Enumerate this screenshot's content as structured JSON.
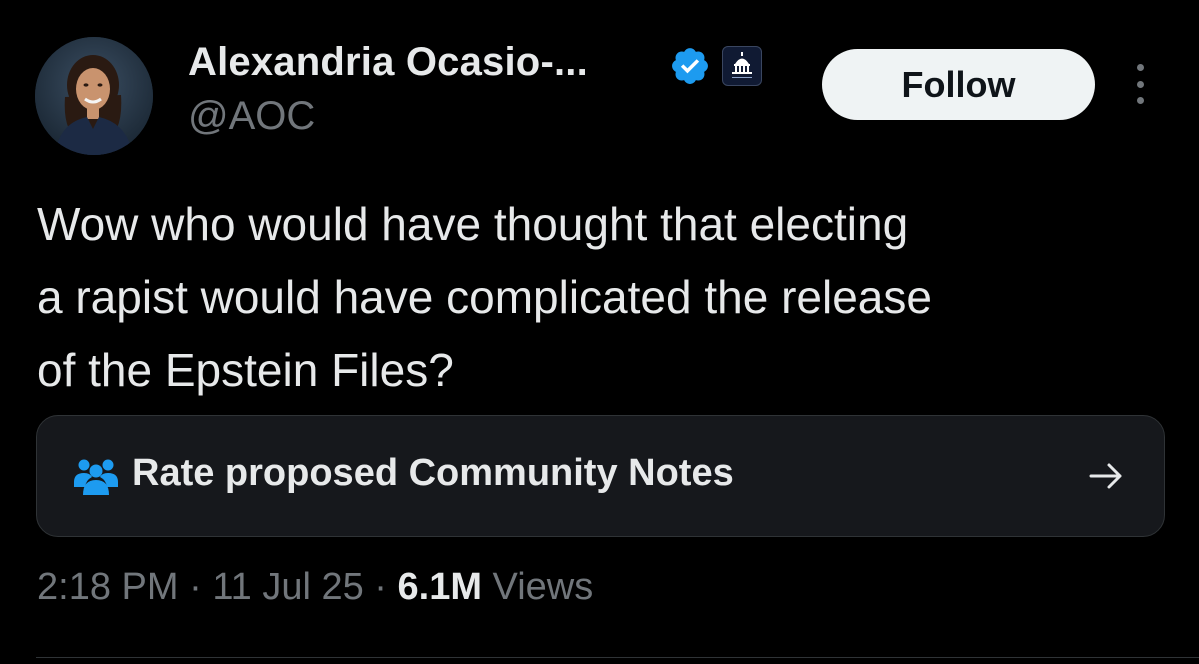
{
  "author": {
    "display_name": "Alexandria Ocasio-...",
    "handle": "@AOC",
    "verified_icon": "verified-badge-icon",
    "affiliate_icon": "capitol-building-icon",
    "avatar_icon": "profile-photo"
  },
  "actions": {
    "follow_label": "Follow",
    "more_icon": "more-options-icon"
  },
  "tweet": {
    "lines": [
      "Wow who would have thought that electing",
      "a rapist would have complicated the release",
      "of the Epstein Files?"
    ]
  },
  "community_notes": {
    "label": "Rate proposed Community Notes",
    "icon": "people-icon",
    "arrow_icon": "arrow-right-icon"
  },
  "meta": {
    "time": "2:18 PM",
    "separator": "·",
    "date": "11 Jul 25",
    "views_count": "6.1M",
    "views_label": "Views"
  },
  "colors": {
    "background": "#000000",
    "text_primary": "#e7e9ea",
    "text_secondary": "#71767b",
    "verified_blue": "#1d9bf0",
    "notes_icon_blue": "#1d9bf0",
    "card_background": "#16181c",
    "border": "#2f3336"
  }
}
